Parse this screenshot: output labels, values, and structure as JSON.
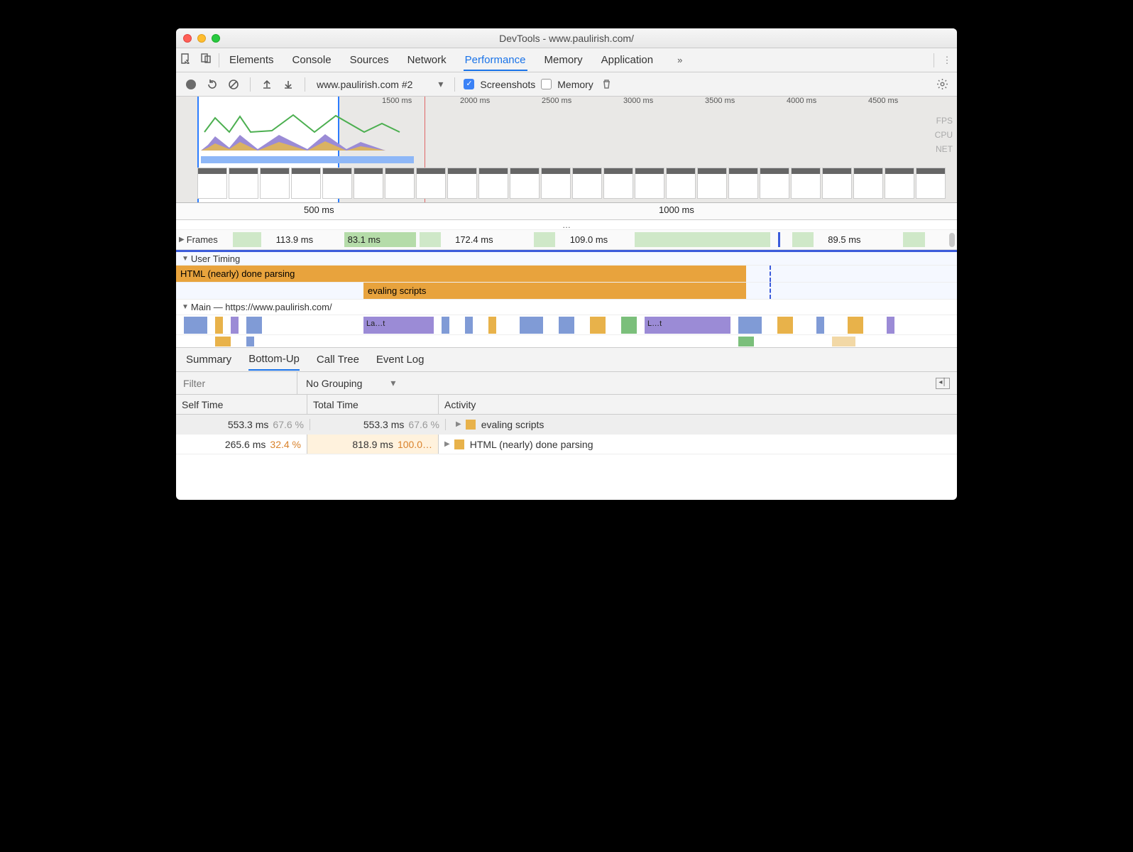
{
  "window": {
    "title": "DevTools - www.paulirish.com/"
  },
  "mainTabs": {
    "items": [
      "Elements",
      "Console",
      "Sources",
      "Network",
      "Performance",
      "Memory",
      "Application"
    ],
    "active": "Performance",
    "more": "»"
  },
  "toolbar": {
    "recordingName": "www.paulirish.com #2",
    "screenshotsLabel": "Screenshots",
    "memoryLabel": "Memory",
    "screenshotsChecked": true,
    "memoryChecked": false
  },
  "overview": {
    "ticks": [
      "500 ms",
      "1000 ms",
      "1500 ms",
      "2000 ms",
      "2500 ms",
      "3000 ms",
      "3500 ms",
      "4000 ms",
      "4500 ms"
    ],
    "laneLabels": [
      "FPS",
      "CPU",
      "NET"
    ]
  },
  "ruler": {
    "t1": "500 ms",
    "t2": "1000 ms"
  },
  "ellipsis": "…",
  "frames": {
    "label": "Frames",
    "items": [
      "113.9 ms",
      "83.1 ms",
      "172.4 ms",
      "109.0 ms",
      "89.5 ms"
    ]
  },
  "userTiming": {
    "header": "User Timing",
    "rows": [
      {
        "label": "HTML (nearly) done parsing",
        "leftPct": 0,
        "widthPct": 73
      },
      {
        "label": "evaling scripts",
        "leftPct": 24,
        "widthPct": 49
      }
    ],
    "dashedMarkerPct": 76
  },
  "mainThread": {
    "label": "Main — https://www.paulirish.com/",
    "tags": [
      "La…t",
      "L…t"
    ]
  },
  "bottomTabs": {
    "items": [
      "Summary",
      "Bottom-Up",
      "Call Tree",
      "Event Log"
    ],
    "active": "Bottom-Up"
  },
  "filter": {
    "placeholder": "Filter",
    "grouping": "No Grouping"
  },
  "table": {
    "headers": {
      "self": "Self Time",
      "total": "Total Time",
      "activity": "Activity"
    },
    "rows": [
      {
        "self_ms": "553.3 ms",
        "self_pct": "67.6 %",
        "total_ms": "553.3 ms",
        "total_pct": "67.6 %",
        "activity": "evaling scripts",
        "selected": true
      },
      {
        "self_ms": "265.6 ms",
        "self_pct": "32.4 %",
        "total_ms": "818.9 ms",
        "total_pct": "100.0…",
        "activity": "HTML (nearly) done parsing",
        "selected": false
      }
    ]
  }
}
